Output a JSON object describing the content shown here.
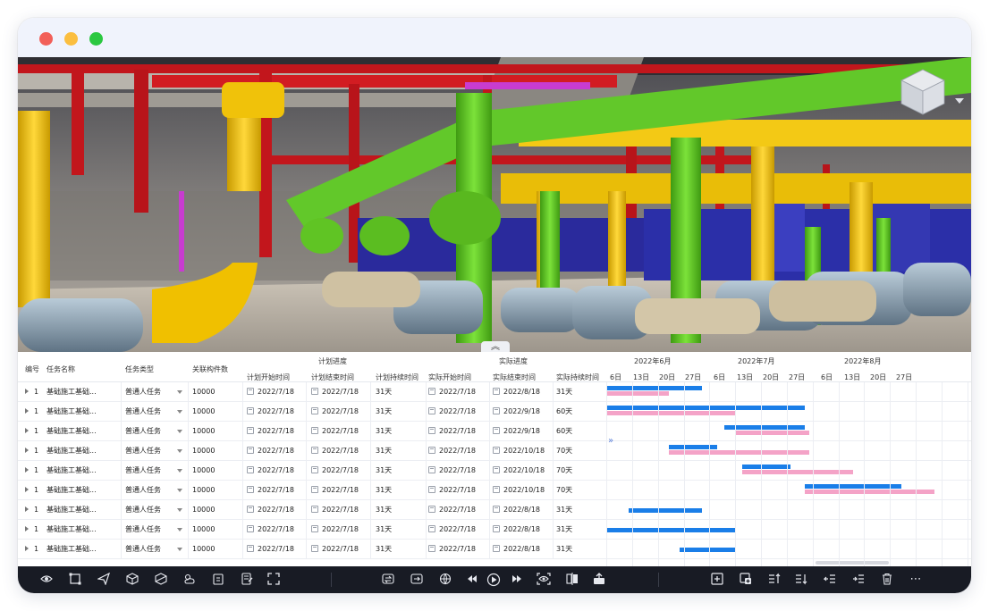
{
  "window": {
    "controls": [
      "close",
      "minimize",
      "maximize"
    ]
  },
  "scene": {
    "collapse_label": "︽"
  },
  "table": {
    "headers": {
      "id": "编号",
      "name": "任务名称",
      "type": "任务类型",
      "count": "关联构件数",
      "plan_group": "计划进度",
      "plan_start": "计划开始时间",
      "plan_end": "计划结束时间",
      "plan_duration": "计划持续时间",
      "actual_group": "实际进度",
      "actual_start": "实际开始时间",
      "actual_end": "实际结束时间",
      "actual_duration": "实际持续时间"
    },
    "timeline": {
      "months": [
        "2022年6月",
        "2022年7月",
        "2022年8月"
      ],
      "days": [
        "6日",
        "13日",
        "20日",
        "27日",
        "6日",
        "13日",
        "20日",
        "27日",
        "6日",
        "13日",
        "20日",
        "27日"
      ]
    },
    "rows": [
      {
        "id": "1",
        "name": "基础施工基础...",
        "type": "普通人任务",
        "count": "10000",
        "plan_start": "2022/7/18",
        "plan_end": "2022/7/18",
        "plan_duration": "31天",
        "actual_start": "2022/7/18",
        "actual_end": "2022/8/18",
        "actual_duration": "31天"
      },
      {
        "id": "1",
        "name": "基础施工基础...",
        "type": "普通人任务",
        "count": "10000",
        "plan_start": "2022/7/18",
        "plan_end": "2022/7/18",
        "plan_duration": "31天",
        "actual_start": "2022/7/18",
        "actual_end": "2022/9/18",
        "actual_duration": "60天"
      },
      {
        "id": "1",
        "name": "基础施工基础...",
        "type": "普通人任务",
        "count": "10000",
        "plan_start": "2022/7/18",
        "plan_end": "2022/7/18",
        "plan_duration": "31天",
        "actual_start": "2022/7/18",
        "actual_end": "2022/9/18",
        "actual_duration": "60天"
      },
      {
        "id": "1",
        "name": "基础施工基础...",
        "type": "普通人任务",
        "count": "10000",
        "plan_start": "2022/7/18",
        "plan_end": "2022/7/18",
        "plan_duration": "31天",
        "actual_start": "2022/7/18",
        "actual_end": "2022/10/18",
        "actual_duration": "70天"
      },
      {
        "id": "1",
        "name": "基础施工基础...",
        "type": "普通人任务",
        "count": "10000",
        "plan_start": "2022/7/18",
        "plan_end": "2022/7/18",
        "plan_duration": "31天",
        "actual_start": "2022/7/18",
        "actual_end": "2022/10/18",
        "actual_duration": "70天"
      },
      {
        "id": "1",
        "name": "基础施工基础...",
        "type": "普通人任务",
        "count": "10000",
        "plan_start": "2022/7/18",
        "plan_end": "2022/7/18",
        "plan_duration": "31天",
        "actual_start": "2022/7/18",
        "actual_end": "2022/10/18",
        "actual_duration": "70天"
      },
      {
        "id": "1",
        "name": "基础施工基础...",
        "type": "普通人任务",
        "count": "10000",
        "plan_start": "2022/7/18",
        "plan_end": "2022/7/18",
        "plan_duration": "31天",
        "actual_start": "2022/7/18",
        "actual_end": "2022/8/18",
        "actual_duration": "31天"
      },
      {
        "id": "1",
        "name": "基础施工基础...",
        "type": "普通人任务",
        "count": "10000",
        "plan_start": "2022/7/18",
        "plan_end": "2022/7/18",
        "plan_duration": "31天",
        "actual_start": "2022/7/18",
        "actual_end": "2022/8/18",
        "actual_duration": "31天"
      },
      {
        "id": "1",
        "name": "基础施工基础...",
        "type": "普通人任务",
        "count": "10000",
        "plan_start": "2022/7/18",
        "plan_end": "2022/7/18",
        "plan_duration": "31天",
        "actual_start": "2022/7/18",
        "actual_end": "2022/8/18",
        "actual_duration": "31天"
      }
    ]
  },
  "toolbar": {
    "more_label": "⋯",
    "colors": {
      "background": "#181b24",
      "plan_bar": "#1a7ee8",
      "actual_bar": "#f4a3c7"
    }
  }
}
